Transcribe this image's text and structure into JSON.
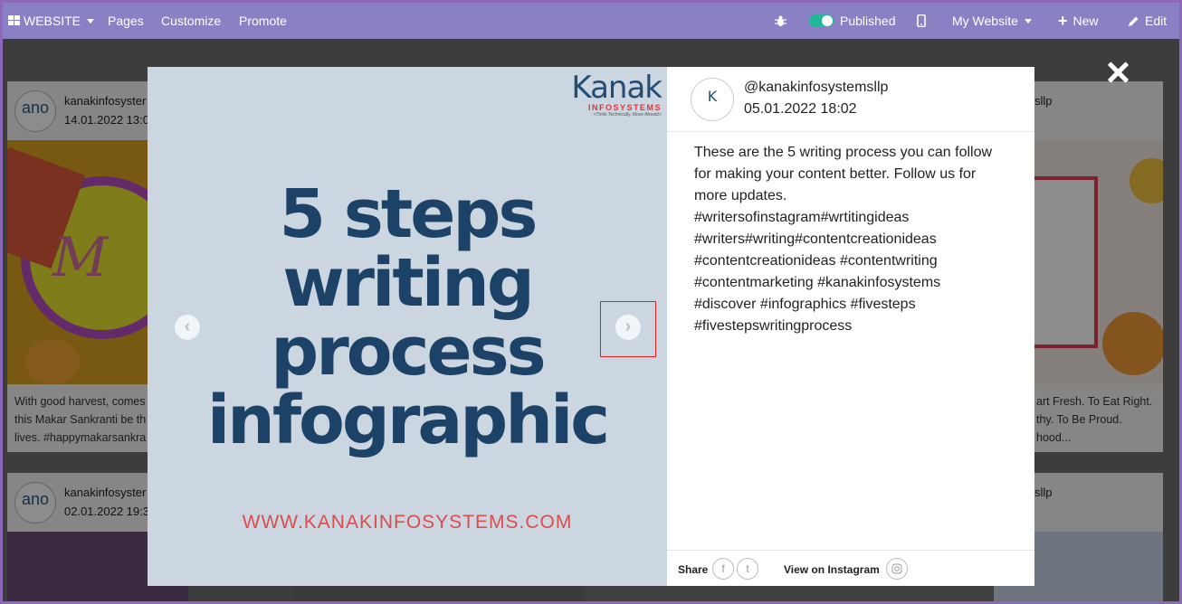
{
  "topbar": {
    "website_label": "WEBSITE",
    "pages": "Pages",
    "customize": "Customize",
    "promote": "Promote",
    "published": "Published",
    "my_website": "My Website",
    "new": "New",
    "edit": "Edit"
  },
  "background_cards": [
    {
      "username": "kanakinfosyster",
      "date": "14.01.2022 13:0",
      "text": [
        "With good harvest, comes",
        "this Makar Sankranti be th",
        "lives. #happymakarsankra"
      ]
    },
    {
      "username": "kanakinfosyster",
      "date": "02.01.2022 19:3"
    },
    {
      "username_tail": "sllp",
      "text": [
        "art Fresh. To Eat Right.",
        "thy. To Be Proud.",
        "hood..."
      ]
    },
    {
      "username_tail": "sllp"
    }
  ],
  "modal": {
    "post_image": {
      "logo_brand": "Kanak",
      "logo_sub": "INFOSYSTEMS",
      "logo_tagline": "<Think Technically. Move Ahead/>",
      "headline": [
        "5 steps",
        "writing",
        "process",
        "infographic"
      ],
      "website": "WWW.KANAKINFOSYSTEMS.COM"
    },
    "handle": "@kanakinfosystemsllp",
    "date": "05.01.2022 18:02",
    "caption": "These are the 5 writing process you can follow for making your content better. Follow us for more updates. #writersofinstagram#wrtitingideas #writers#writing#contentcreationideas #contentcreationideas #contentwriting #contentmarketing #kanakinfosystems #discover #infographics #fivesteps #fivestepswritingprocess",
    "share_label": "Share",
    "view_on_instagram": "View on Instagram"
  }
}
